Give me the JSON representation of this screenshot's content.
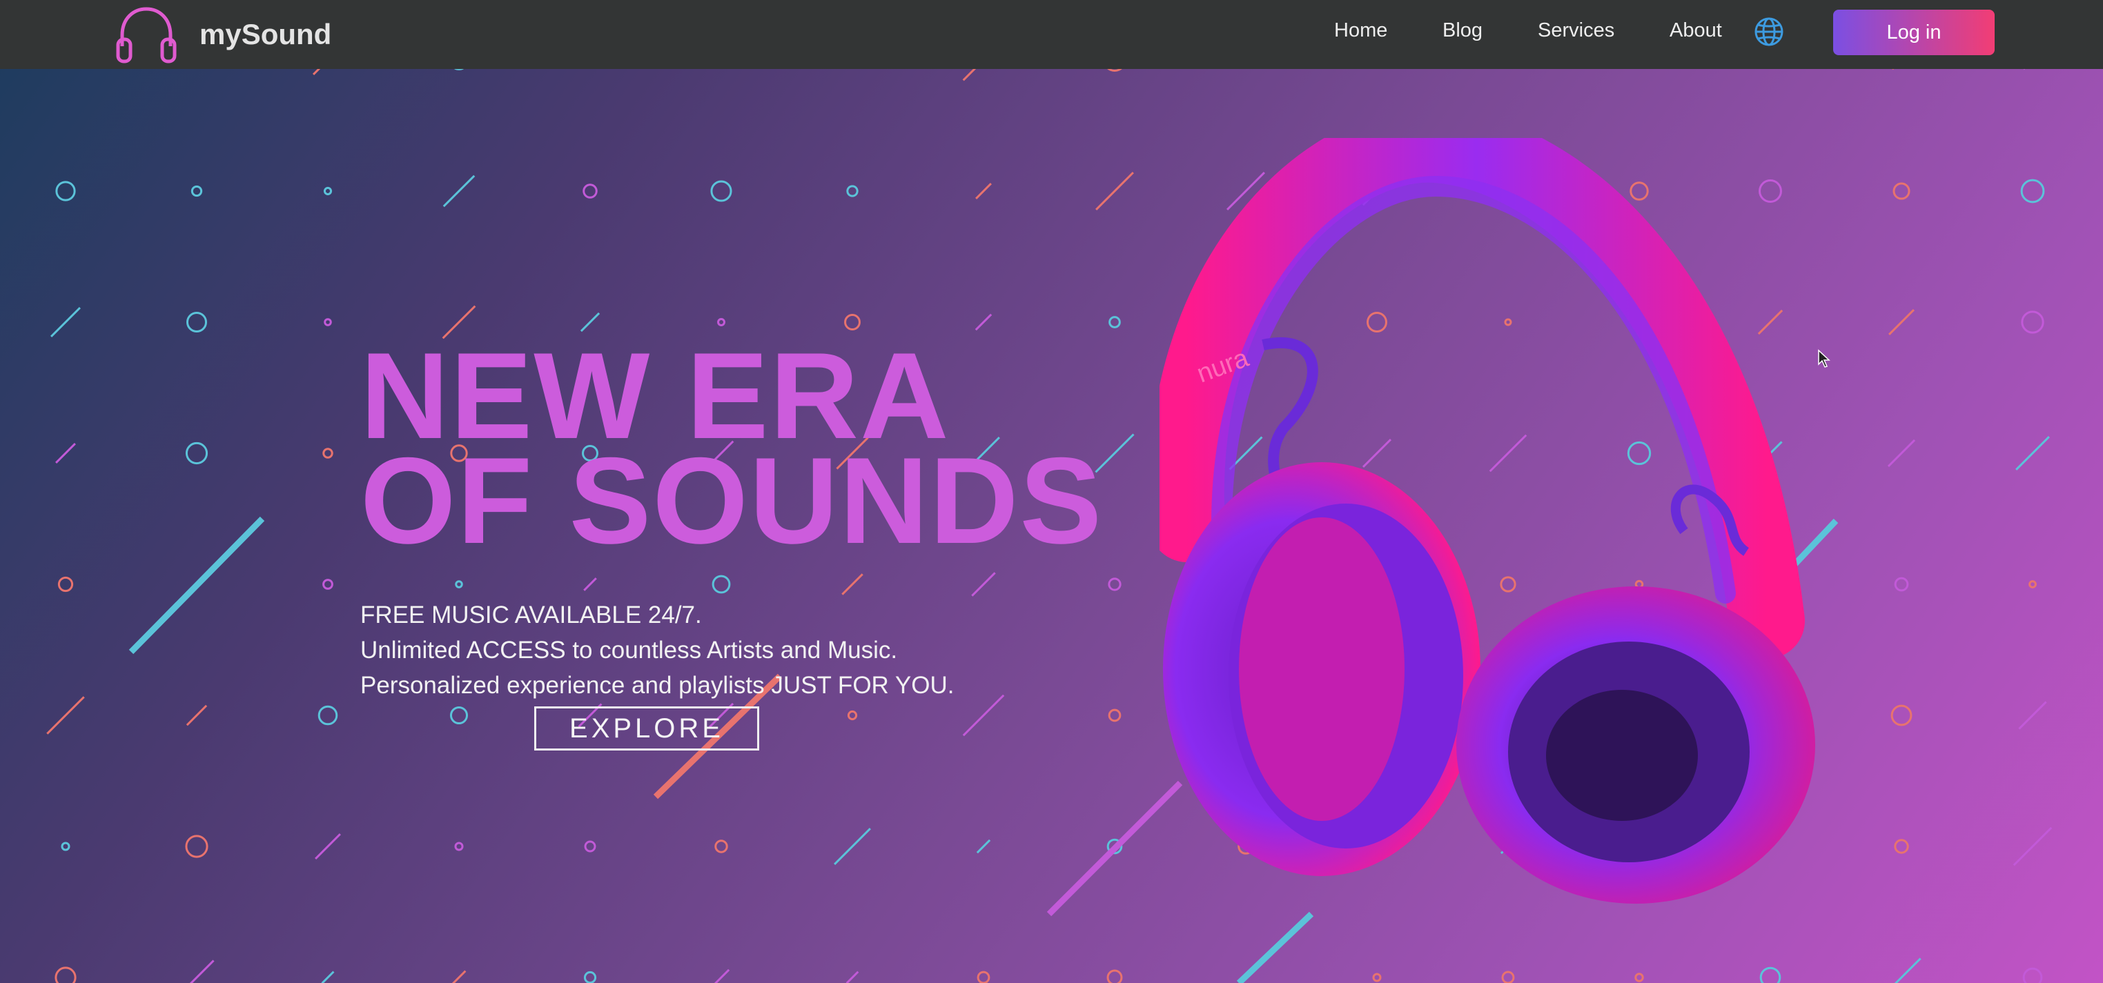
{
  "header": {
    "brand": "mySound",
    "nav": [
      "Home",
      "Blog",
      "Services",
      "About"
    ],
    "login_label": "Log in"
  },
  "hero": {
    "title_line1": "NEW ERA",
    "title_line2": "OF SOUNDS",
    "lines": [
      "FREE MUSIC AVAILABLE 24/7.",
      "Unlimited ACCESS to countless Artists and Music.",
      "Personalized experience and playlists JUST FOR YOU."
    ],
    "cta_label": "EXPLORE",
    "product_brand_mark": "nura"
  },
  "icons": {
    "logo": "headphones-icon",
    "language": "globe-icon",
    "pointer": "mouse-cursor-icon"
  },
  "colors": {
    "navbar": "#333535",
    "title": "#cc5cdc",
    "login_gradient_start": "#7b4fe3",
    "login_gradient_end": "#f23d74",
    "pattern": [
      "#e8736e",
      "#5bc3d9",
      "#c25ad8"
    ]
  }
}
